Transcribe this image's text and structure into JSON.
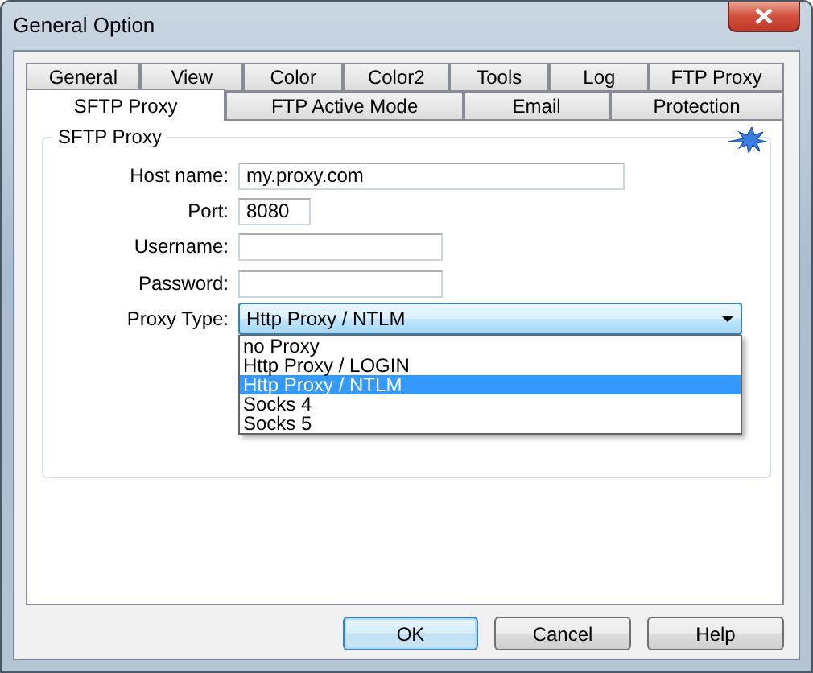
{
  "window": {
    "title": "General Option"
  },
  "tab_rows": [
    [
      {
        "label": "General",
        "selected": false
      },
      {
        "label": "View",
        "selected": false
      },
      {
        "label": "Color",
        "selected": false
      },
      {
        "label": "Color2",
        "selected": false
      },
      {
        "label": "Tools",
        "selected": false
      },
      {
        "label": "Log",
        "selected": false
      },
      {
        "label": "FTP Proxy",
        "selected": false
      }
    ],
    [
      {
        "label": "SFTP Proxy",
        "selected": true
      },
      {
        "label": "FTP Active Mode",
        "selected": false
      },
      {
        "label": "Email",
        "selected": false
      },
      {
        "label": "Protection",
        "selected": false
      }
    ]
  ],
  "group": {
    "title": "SFTP Proxy",
    "fields": [
      {
        "label": "Host name:",
        "value": "my.proxy.com",
        "kind": "wide"
      },
      {
        "label": "Port:",
        "value": "8080",
        "kind": "short"
      },
      {
        "label": "Username:",
        "kind": "medium"
      },
      {
        "label": "Password:",
        "kind": "medium"
      }
    ],
    "proxy_type": {
      "label": "Proxy Type:",
      "value": "Http Proxy / NTLM",
      "expanded": true,
      "options": [
        {
          "label": "no Proxy",
          "selected": false
        },
        {
          "label": "Http Proxy / LOGIN",
          "selected": false
        },
        {
          "label": "Http Proxy / NTLM",
          "selected": true
        },
        {
          "label": "Socks 4",
          "selected": false
        },
        {
          "label": "Socks 5",
          "selected": false
        }
      ]
    }
  },
  "buttons": [
    {
      "label": "OK",
      "default": true
    },
    {
      "label": "Cancel",
      "default": false
    },
    {
      "label": "Help",
      "default": false
    }
  ]
}
